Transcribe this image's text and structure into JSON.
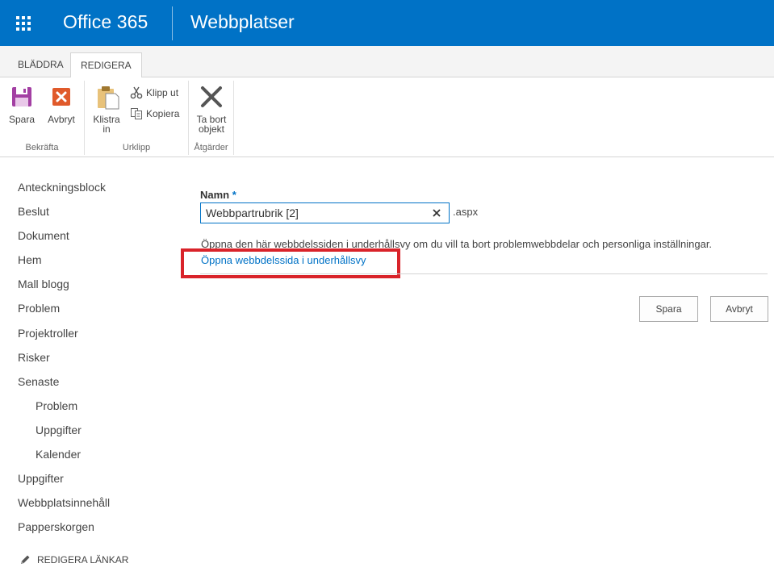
{
  "suite": {
    "brand": "Office 365",
    "title": "Webbplatser"
  },
  "ribbon": {
    "tabs": [
      {
        "label": "BLÄDDRA"
      },
      {
        "label": "REDIGERA"
      }
    ],
    "groups": {
      "confirm": {
        "label": "Bekräfta",
        "save": "Spara",
        "cancel": "Avbryt"
      },
      "clipboard": {
        "label": "Urklipp",
        "paste_line1": "Klistra",
        "paste_line2": "in",
        "cut": "Klipp ut",
        "copy": "Kopiera"
      },
      "actions": {
        "label": "Åtgärder",
        "delete_line1": "Ta bort",
        "delete_line2": "objekt"
      }
    }
  },
  "nav": {
    "items": [
      {
        "label": "Anteckningsblock"
      },
      {
        "label": "Beslut"
      },
      {
        "label": "Dokument"
      },
      {
        "label": "Hem"
      },
      {
        "label": "Mall blogg"
      },
      {
        "label": "Problem"
      },
      {
        "label": "Projektroller"
      },
      {
        "label": "Risker"
      },
      {
        "label": "Senaste"
      },
      {
        "label": "Problem"
      },
      {
        "label": "Uppgifter"
      },
      {
        "label": "Kalender"
      },
      {
        "label": "Uppgifter"
      },
      {
        "label": "Webbplatsinnehåll"
      },
      {
        "label": "Papperskorgen"
      }
    ],
    "edit_links": "REDIGERA LÄNKAR"
  },
  "form": {
    "name_label": "Namn",
    "required_marker": "*",
    "name_value": "Webbpartrubrik [2]",
    "extension": ".aspx",
    "info_text": "Öppna den här webbdelssiden i underhållsvy om du vill ta bort problemwebbdelar och personliga inställningar.",
    "maintenance_link": "Öppna webbdelssida i underhållsvy",
    "save_button": "Spara",
    "cancel_button": "Avbryt"
  },
  "colors": {
    "suitebar": "#0072c6",
    "link": "#0072c6",
    "highlight": "#d9232a"
  }
}
